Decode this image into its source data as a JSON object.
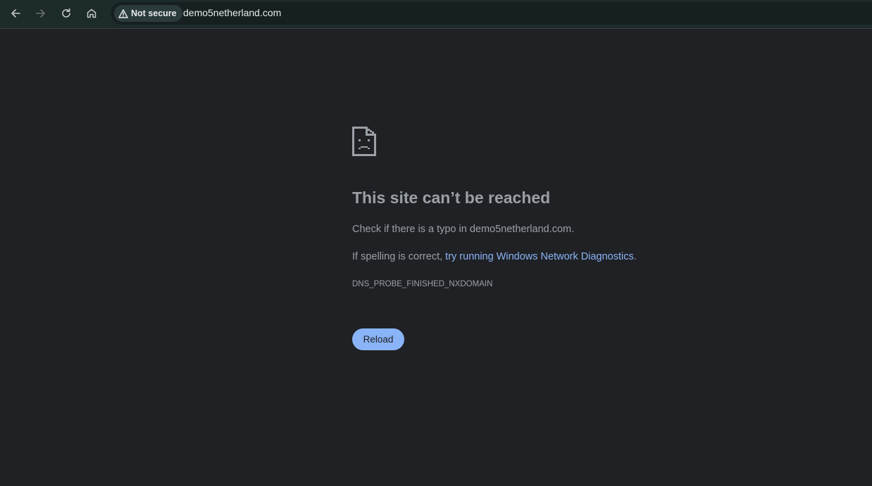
{
  "browser": {
    "nav": {
      "back_icon": "arrow-left-icon",
      "forward_icon": "arrow-right-icon",
      "reload_icon": "reload-icon",
      "home_icon": "home-icon"
    },
    "security_chip": {
      "icon": "warning-triangle-icon",
      "label": "Not secure"
    },
    "url": "demo5netherland.com"
  },
  "error_page": {
    "icon": "sad-document-icon",
    "title": "This site can’t be reached",
    "typo_message": "Check if there is a typo in demo5netherland.com.",
    "spelling_prefix": "If spelling is correct, ",
    "diagnostics_link": "try running Windows Network Diagnostics",
    "spelling_suffix": ".",
    "error_code": "DNS_PROBE_FINISHED_NXDOMAIN",
    "reload_label": "Reload"
  },
  "colors": {
    "page_background": "#202124",
    "toolbar_background": "#1d2b2b",
    "text_secondary": "#9aa0a6",
    "link": "#8ab4f8",
    "button_background": "#8ab4f8"
  }
}
